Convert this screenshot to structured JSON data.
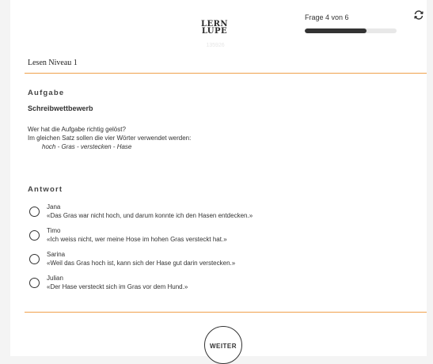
{
  "header": {
    "logo_line1": "LERN",
    "logo_line2": "LUPE",
    "page_id": "135926",
    "question_counter": "Frage 4 von 6",
    "progress_fraction": 0.67
  },
  "level": {
    "title": "Lesen Niveau 1"
  },
  "task": {
    "heading": "Aufgabe",
    "title": "Schreibwettbewerb",
    "line1": "Wer hat die Aufgabe richtig gelöst?",
    "line2": "Im gleichen Satz sollen die vier Wörter verwendet werden:",
    "words": "hoch - Gras - verstecken  - Hase"
  },
  "answer": {
    "heading": "Antwort",
    "options": [
      {
        "name": "Jana",
        "quote": "«Das Gras war nicht hoch, und darum konnte ich den Hasen entdecken.»"
      },
      {
        "name": "Timo",
        "quote": "«Ich weiss nicht, wer meine Hose im hohen Gras versteckt hat.»"
      },
      {
        "name": "Sarina",
        "quote": "«Weil das Gras hoch ist, kann sich der Hase gut darin verstecken.»"
      },
      {
        "name": "Julian",
        "quote": "«Der Hase versteckt sich im Gras vor dem Hund.»"
      }
    ]
  },
  "footer": {
    "next_label": "WEITER"
  },
  "icons": {
    "restart": "restart-icon"
  },
  "colors": {
    "accent": "#f0a04b",
    "progress": "#333333",
    "track": "#e8e8e8"
  }
}
